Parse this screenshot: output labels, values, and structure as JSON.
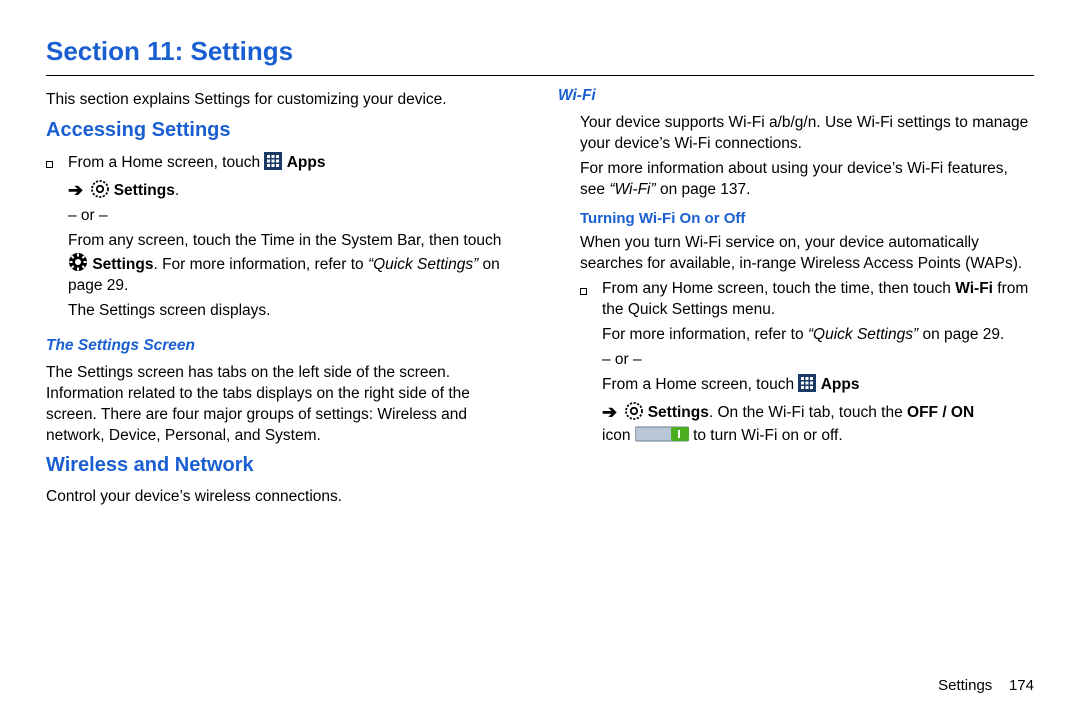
{
  "title": "Section 11: Settings",
  "intro": "This section explains Settings for customizing your device.",
  "left": {
    "accessing_h": "Accessing Settings",
    "step_from_home": "From a Home screen, touch ",
    "apps_label": "Apps",
    "settings_label": "Settings",
    "or": "– or –",
    "from_any_a": "From any screen, touch the Time in the System Bar, then touch ",
    "from_any_b": ". For more information, refer to ",
    "quick_settings": "“Quick Settings”",
    "on_page29": " on page 29.",
    "settings_displays": "The Settings screen displays.",
    "settings_screen_h": "The Settings Screen",
    "settings_screen_p": "The Settings screen has tabs on the left side of the screen. Information related to the tabs displays on the right side of the screen. There are four major groups of settings: Wireless and network, Device, Personal, and System.",
    "wireless_h": "Wireless and Network",
    "wireless_p": "Control your device’s wireless connections."
  },
  "right": {
    "wifi_h": "Wi-Fi",
    "wifi_p1": "Your device supports Wi-Fi a/b/g/n. Use Wi-Fi settings to manage your device’s Wi-Fi connections.",
    "wifi_p2a": "For more information about using your device’s Wi-Fi features, see ",
    "wifi_ref": "“Wi-Fi”",
    "wifi_p2b": " on page 137.",
    "toggle_h": "Turning Wi-Fi On or Off",
    "toggle_p": "When you turn Wi-Fi service on, your device automatically searches for available, in-range Wireless Access Points (WAPs).",
    "bullet_a": "From any Home screen, touch the time, then touch ",
    "wifi_bold": "Wi-Fi",
    "bullet_b": " from the Quick Settings menu.",
    "more_info_a": "For more information, refer to ",
    "more_info_b": " on page 29.",
    "or": "– or –",
    "from_home": "From a Home screen, touch ",
    "apps_label": "Apps",
    "settings_label": "Settings",
    "tail_a": ". On the Wi-Fi tab, touch the ",
    "offon": "OFF / ON",
    "tail_b": " icon ",
    "tail_c": " to turn Wi-Fi on or off."
  },
  "footer": {
    "label": "Settings",
    "page": "174"
  }
}
